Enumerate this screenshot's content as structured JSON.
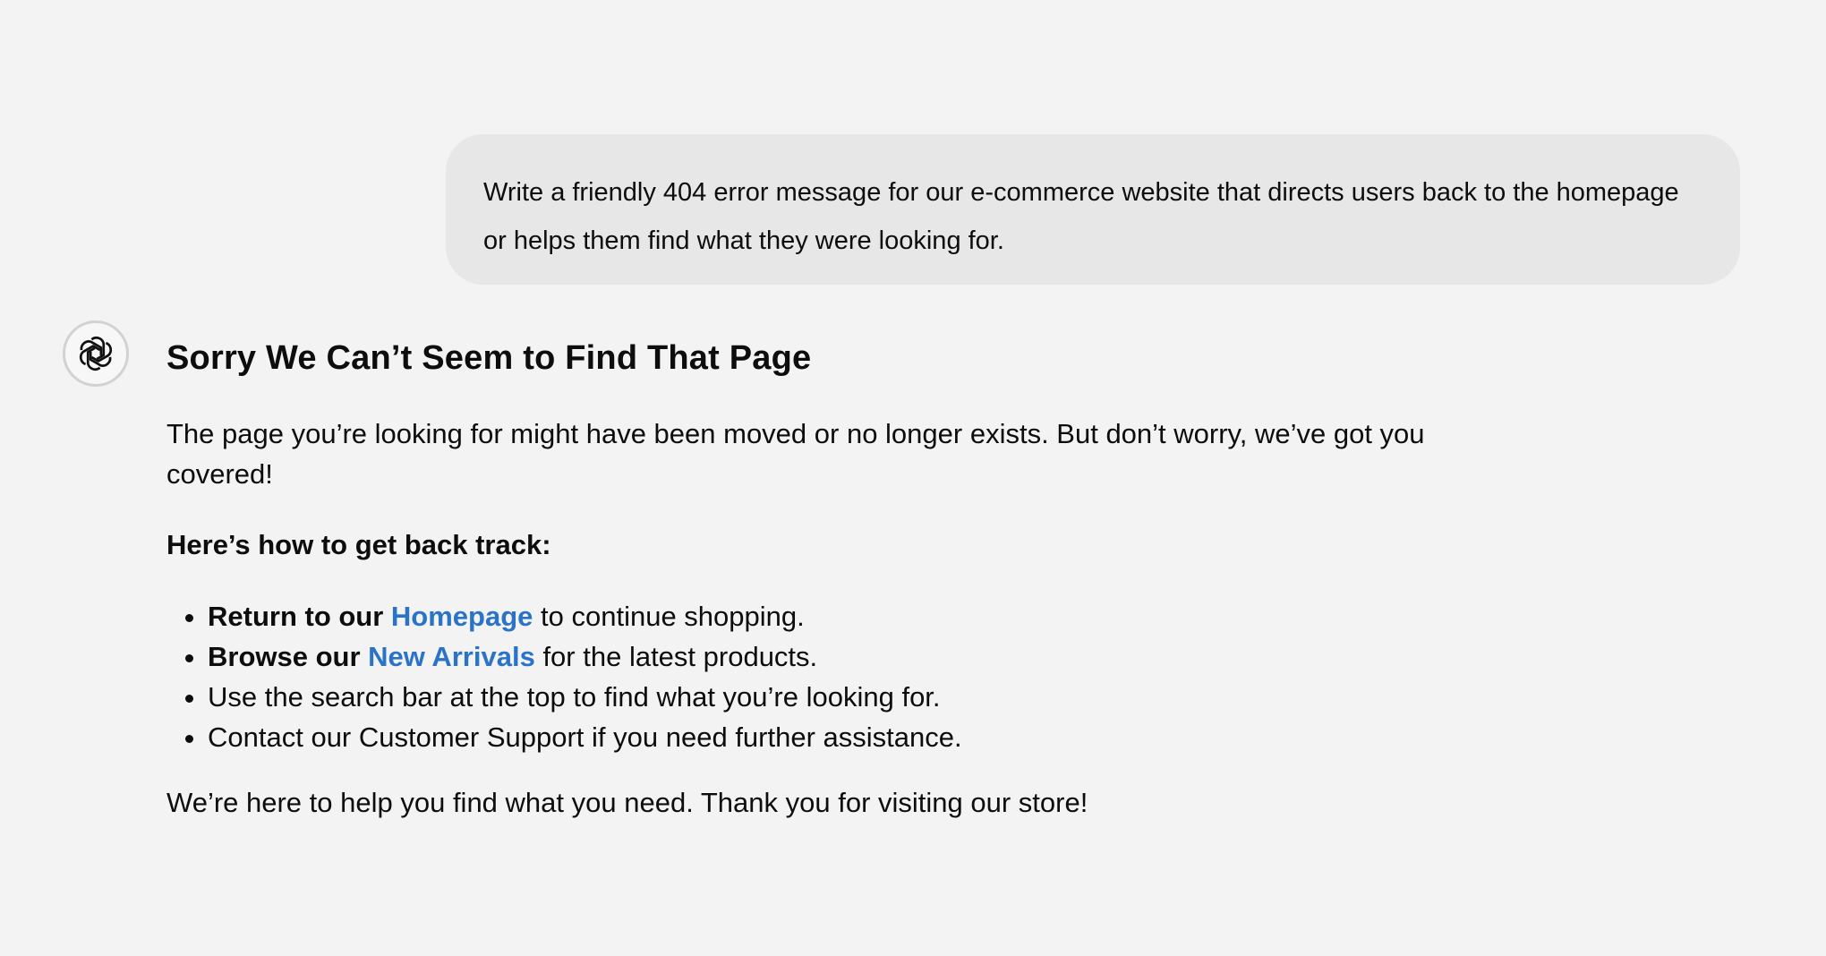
{
  "user_message": {
    "text": "Write a friendly 404 error message for our e-commerce website that directs users back to the homepage or helps them find what they were looking for."
  },
  "assistant": {
    "avatar_icon": "openai-logo-icon",
    "heading": "Sorry We Can’t Seem to Find That Page",
    "intro": "The page you’re looking for might have been moved or no longer exists. But don’t worry, we’ve got you covered!",
    "howto_heading": "Here’s how to get back track:",
    "list": [
      {
        "bold": "Return to our ",
        "link": "Homepage",
        "rest": " to continue shopping."
      },
      {
        "bold": "Browse our ",
        "link": "New Arrivals",
        "rest": " for the latest products."
      },
      {
        "text": "Use the search bar at the top to find what you’re looking for."
      },
      {
        "text": "Contact our Customer Support if you need further assistance."
      }
    ],
    "outro": "We’re here to help you find what you need. Thank you for visiting our store!"
  },
  "colors": {
    "background": "#f3f3f3",
    "user_bubble": "#e7e7e8",
    "link": "#2a73c8",
    "text": "#0d0d0d"
  }
}
